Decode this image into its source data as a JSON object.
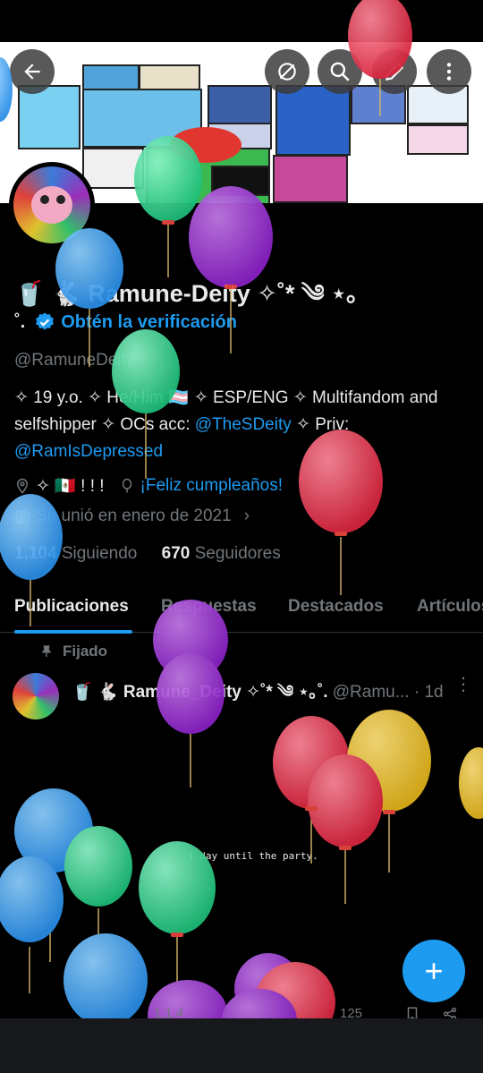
{
  "profile": {
    "name": "🥤 🐇 Ramune-Deity ✧˚* ༄ ⋆｡",
    "name_tail": "˚.",
    "verify_label": "Obtén la verificación",
    "handle": "@RamuneDeity",
    "bio_part1": "✧ 19 y.o. ✧ He/Him 🏳️‍⚧️ ✧ ESP/ENG ✧ Multifandom and selfshipper ✧ OCs acc: ",
    "bio_link1": "@TheSDeity",
    "bio_part2": " ✧ Priv: ",
    "bio_link2": "@RamIsDepressed",
    "location": "✧ 🇲🇽 ! ! !",
    "birthday": "¡Feliz cumpleaños!",
    "joined": "Se unió en enero de 2021",
    "following_count": "1,104",
    "following_label": "Siguiendo",
    "followers_count": "670",
    "followers_label": "Seguidores"
  },
  "tabs": [
    "Publicaciones",
    "Respuestas",
    "Destacados",
    "Artículos"
  ],
  "post": {
    "pinned_label": "Fijado",
    "author": "🥤 🐇 Ramune_Deity ✧˚* ༄ ⋆｡˚.",
    "handle": "@Ramu...",
    "time": "· 1d",
    "text": "1 day until the party.",
    "likes": "1,1.4",
    "views": "125"
  },
  "colors": {
    "accent": "#1d9bf0",
    "background": "#000000",
    "muted": "#71767b"
  },
  "icons": [
    "back-arrow-icon",
    "no-sensitive-icon",
    "search-icon",
    "edit-icon",
    "more-vertical-icon",
    "verified-badge-icon",
    "location-icon",
    "balloon-icon",
    "calendar-icon",
    "pin-icon",
    "bookmark-icon",
    "share-icon",
    "plus-icon"
  ]
}
